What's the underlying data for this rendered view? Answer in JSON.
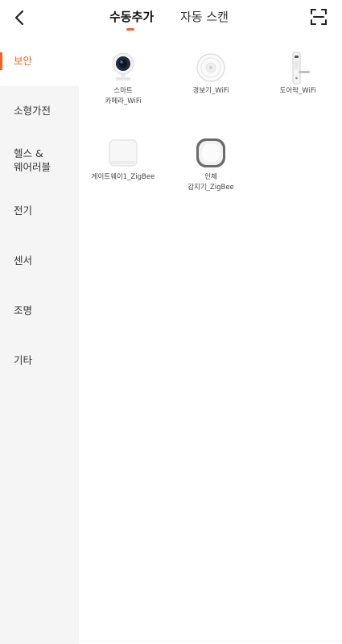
{
  "header": {
    "tab_manual": "수동추가",
    "tab_auto": "자동 스캔",
    "accent_color": "#f26522",
    "back_icon": "chevron-left-icon",
    "scan_icon": "scan-frame-icon"
  },
  "sidebar": {
    "items": [
      {
        "label": "보안"
      },
      {
        "label": "소형가전"
      },
      {
        "label": "헬스 &\n웨어러블"
      },
      {
        "label": "전기"
      },
      {
        "label": "센서"
      },
      {
        "label": "조명"
      },
      {
        "label": "기타"
      }
    ]
  },
  "devices": [
    {
      "name": "스마트\n카메라_WiFi",
      "icon": "camera-icon"
    },
    {
      "name": "경보기_WiFi",
      "icon": "alarm-icon"
    },
    {
      "name": "도어락_WiFi",
      "icon": "door-lock-icon"
    },
    {
      "name": "게이트웨이1_ZigBee",
      "icon": "gateway-icon"
    },
    {
      "name": "인체\n감지기_ZigBee",
      "icon": "motion-sensor-icon"
    }
  ]
}
